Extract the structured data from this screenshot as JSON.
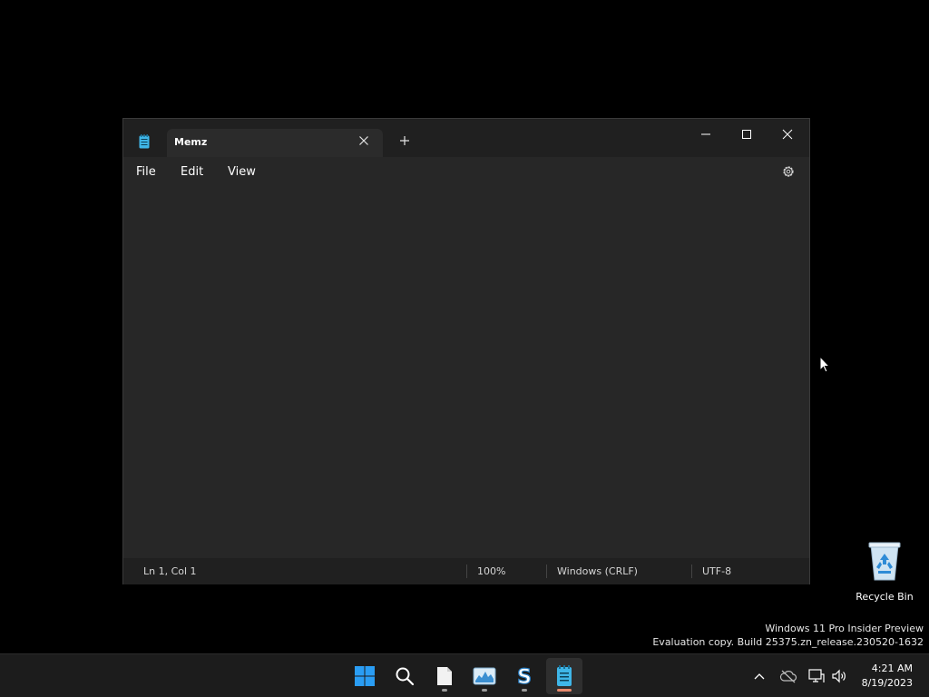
{
  "window": {
    "tab_title": "Memz",
    "menu": {
      "file": "File",
      "edit": "Edit",
      "view": "View"
    },
    "editor_text": "",
    "status": {
      "position": "Ln 1, Col 1",
      "zoom": "100%",
      "line_ending": "Windows (CRLF)",
      "encoding": "UTF-8"
    }
  },
  "desktop": {
    "recycle_bin_label": "Recycle Bin",
    "watermark": {
      "line1": "Windows 11 Pro Insider Preview",
      "line2": "Evaluation copy. Build 25375.zn_release.230520-1632"
    }
  },
  "taskbar": {
    "apps": [
      "start-icon",
      "search-icon",
      "file-icon",
      "task-manager-icon",
      "sharepoint-icon",
      "notepad-icon"
    ],
    "active_app": "notepad-icon",
    "clock": {
      "time": "4:21 AM",
      "date": "8/19/2023"
    }
  },
  "colors": {
    "window_bg": "#272727",
    "titlebar_bg": "#202020",
    "taskbar_bg": "#1c1c1c",
    "notepad_accent": "#3fb6e8",
    "active_indicator": "#e88a6d"
  }
}
